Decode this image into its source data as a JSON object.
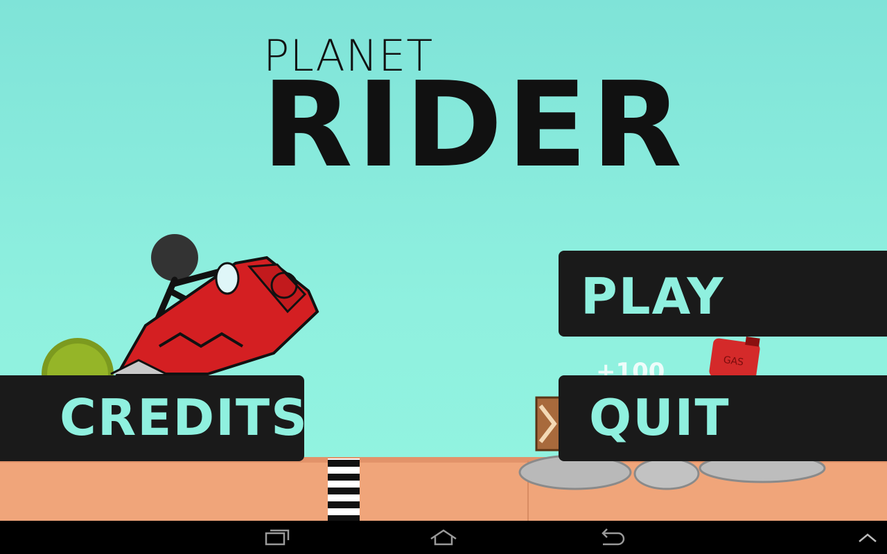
{
  "title": {
    "line1": "PLANET",
    "line2": "RIDER"
  },
  "menu": {
    "play_label": "PLAY",
    "credits_label": "CREDITS",
    "quit_label": "QUIT"
  },
  "scene": {
    "gas_label": "GAS",
    "bonus_label": "+100"
  },
  "colors": {
    "sky": "#8ff0df",
    "ground": "#f0a57a",
    "button_bg": "#1a1a1a",
    "button_text": "#8ff0df",
    "bike_red": "#d41f22"
  },
  "icons": {
    "recent_apps": "recent-apps-icon",
    "home": "home-icon",
    "back": "back-icon",
    "overflow": "chevron-up-icon"
  }
}
